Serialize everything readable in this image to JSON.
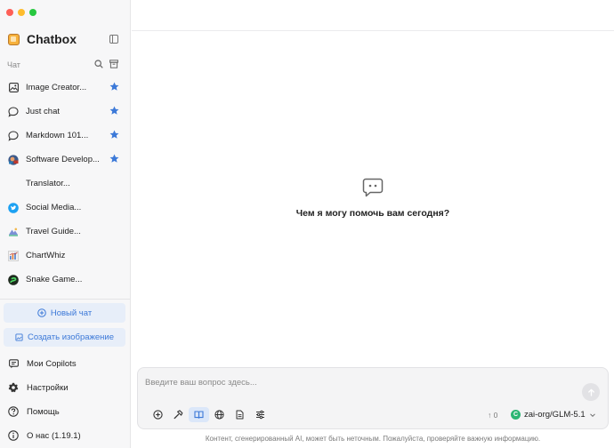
{
  "sidebar": {
    "brand": "Chatbox",
    "section_label": "Чат",
    "chats": [
      {
        "label": "Image Creator...",
        "icon": "image-icon",
        "starred": true
      },
      {
        "label": "Just chat",
        "icon": "chat-bubble-icon",
        "starred": true
      },
      {
        "label": "Markdown 101...",
        "icon": "chat-bubble-icon",
        "starred": true
      },
      {
        "label": "Software Develop...",
        "icon": "developer-avatar-icon",
        "starred": true
      },
      {
        "label": "Translator...",
        "icon": "",
        "starred": false
      },
      {
        "label": "Social Media...",
        "icon": "twitter-bird-icon",
        "starred": false
      },
      {
        "label": "Travel Guide...",
        "icon": "travel-avatar-icon",
        "starred": false
      },
      {
        "label": "ChartWhiz",
        "icon": "chart-avatar-icon",
        "starred": false
      },
      {
        "label": "Snake Game...",
        "icon": "snake-game-icon",
        "starred": false
      }
    ],
    "new_chat": "Новый чат",
    "create_image": "Создать изображение",
    "menu": {
      "copilots": "Мои Copilots",
      "settings": "Настройки",
      "help": "Помощь",
      "about": "О нас (1.19.1)"
    }
  },
  "main": {
    "welcome": "Чем я могу помочь вам сегодня?",
    "composer": {
      "placeholder": "Введите ваш вопрос здесь...",
      "token_count": "↑ 0",
      "model": "zai-org/GLM-5.1",
      "model_badge": "C"
    },
    "disclaimer": "Контент, сгенерированный AI, может быть неточным. Пожалуйста, проверяйте важную информацию."
  },
  "colors": {
    "accent": "#3c79d8",
    "star": "#3c79d8",
    "sidebar_bg": "#f7f7f8"
  }
}
